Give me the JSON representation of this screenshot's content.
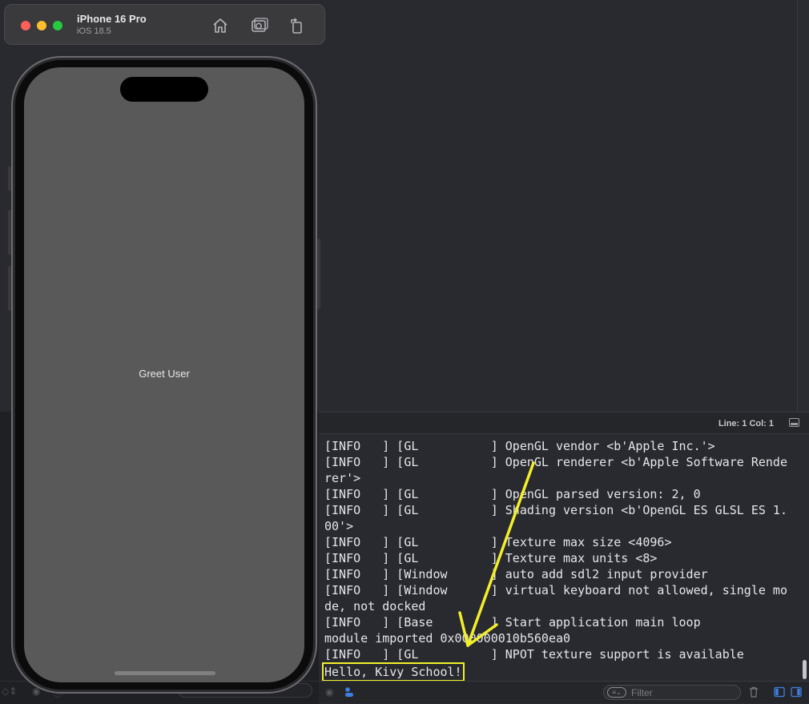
{
  "simulator": {
    "device_name": "iPhone 16 Pro",
    "os_version": "iOS 18.5",
    "toolbar": [
      "home-icon",
      "screenshot-icon",
      "rotate-icon"
    ]
  },
  "app": {
    "button_label": "Greet User"
  },
  "editor": {
    "cursor_position": "Line: 1  Col: 1"
  },
  "console": {
    "lines": [
      "[INFO   ] [GL          ] OpenGL vendor <b'Apple Inc.'>",
      "[INFO   ] [GL          ] OpenGL renderer <b'Apple Software Renderer'>",
      "[INFO   ] [GL          ] OpenGL parsed version: 2, 0",
      "[INFO   ] [GL          ] Shading version <b'OpenGL ES GLSL ES 1.00'>",
      "[INFO   ] [GL          ] Texture max size <4096>",
      "[INFO   ] [GL          ] Texture max units <8>",
      "[INFO   ] [Window      ] auto add sdl2 input provider",
      "[INFO   ] [Window      ] virtual keyboard not allowed, single mode, not docked",
      "[INFO   ] [Base        ] Start application main loop",
      "module imported 0x000000010b560ea0",
      "[INFO   ] [GL          ] NPOT texture support is available"
    ],
    "highlighted_line": "Hello, Kivy School!",
    "filter_placeholder": "Filter",
    "left_filter_placeholder": "Filter"
  },
  "colors": {
    "annotation": "#f2ef2a",
    "console_bg": "#292a30",
    "screen_bg": "#595959"
  }
}
